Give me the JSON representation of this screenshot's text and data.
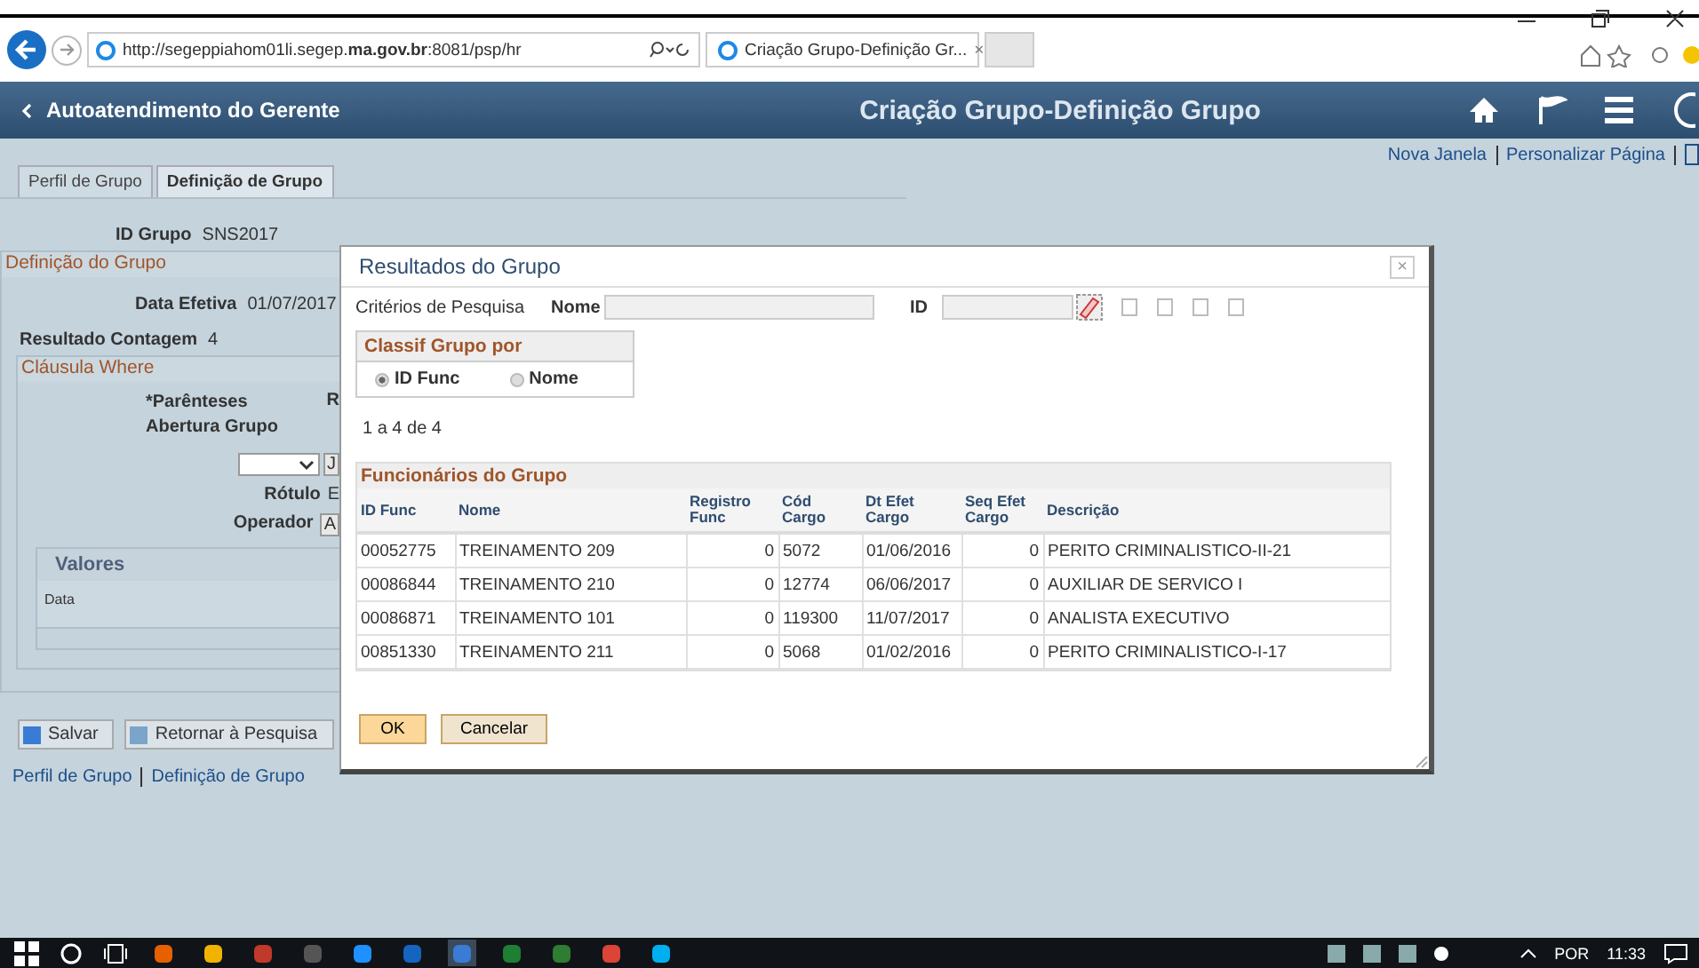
{
  "browser": {
    "url": "http://segeppiahom01li.segep.**ma.gov.br**:8081/psp/hr",
    "tab_title": "Criação Grupo-Definição Gr...",
    "tab_close": "×"
  },
  "header": {
    "back_label": "Autoatendimento do Gerente",
    "title": "Criação Grupo-Definição Grupo"
  },
  "page_links": [
    "Nova Janela",
    "Personalizar Página"
  ],
  "tabs": [
    {
      "label": "Perfil de Grupo",
      "selected": false
    },
    {
      "label": "Definição de Grupo",
      "selected": true
    }
  ],
  "form": {
    "id_label": "ID Grupo",
    "id_value": "SNS2017",
    "section_title": "Definição do Grupo",
    "date_label": "Data Efetiva",
    "date_value": "01/07/2017",
    "count_label": "Resultado Contagem",
    "count_value": "4",
    "where_title": "Cláusula Where",
    "paren_label": "*Parênteses Abertura Grupo",
    "paren_next": "R",
    "select_next": "J",
    "rotulo_label": "Rótulo",
    "rotulo_value": "E",
    "operador_label": "Operador",
    "operador_value": "A",
    "values_title": "Valores",
    "values_column": "Data"
  },
  "buttons": [
    {
      "kind": "save",
      "label": "Salvar"
    },
    {
      "kind": "return",
      "label": "Retornar à Pesquisa"
    }
  ],
  "footer_links": [
    "Perfil de Grupo",
    "Definição de Grupo"
  ],
  "modal": {
    "title": "Resultados do Grupo",
    "close": "×",
    "criteria_label": "Critérios de Pesquisa",
    "name_label": "Nome",
    "id_label": "ID",
    "sort_title": "Classif Grupo por",
    "sort_options": [
      {
        "label": "ID Func",
        "selected": true
      },
      {
        "label": "Nome",
        "selected": false
      }
    ],
    "count": "1 a 4 de 4",
    "grid_title": "Funcionários do Grupo",
    "columns": [
      "ID Func",
      "Nome",
      "Registro Func",
      "Cód Cargo",
      "Dt Efet Cargo",
      "Seq Efet Cargo",
      "Descrição"
    ],
    "rows": [
      [
        "00052775",
        "TREINAMENTO 209",
        "0",
        "5072",
        "01/06/2016",
        "0",
        "PERITO CRIMINALISTICO-II-21"
      ],
      [
        "00086844",
        "TREINAMENTO 210",
        "0",
        "12774",
        "06/06/2017",
        "0",
        "AUXILIAR DE SERVICO I"
      ],
      [
        "00086871",
        "TREINAMENTO 101",
        "0",
        "119300",
        "11/07/2017",
        "0",
        "ANALISTA EXECUTIVO"
      ],
      [
        "00851330",
        "TREINAMENTO 211",
        "0",
        "5068",
        "01/02/2016",
        "0",
        "PERITO CRIMINALISTICO-I-17"
      ]
    ],
    "ok": "OK",
    "cancel": "Cancelar"
  },
  "taskbar": {
    "language": "POR",
    "time": "11:33"
  }
}
